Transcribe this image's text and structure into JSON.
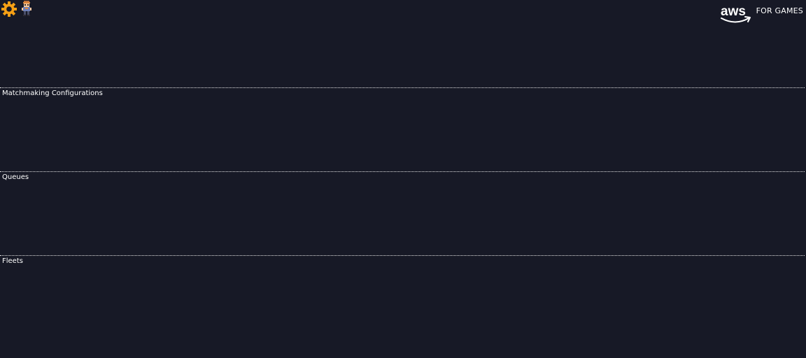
{
  "header": {
    "settings_icon": "gear-icon",
    "player_icon": "player-avatar-icon",
    "brand": {
      "logo_text": "aws",
      "tagline": "FOR GAMES"
    }
  },
  "sections": [
    {
      "label": "Matchmaking Configurations"
    },
    {
      "label": "Queues"
    },
    {
      "label": "Fleets"
    }
  ],
  "colors": {
    "background": "#171926",
    "accent": "#f5a015",
    "divider": "#e6e6e6",
    "text": "#ffffff"
  }
}
